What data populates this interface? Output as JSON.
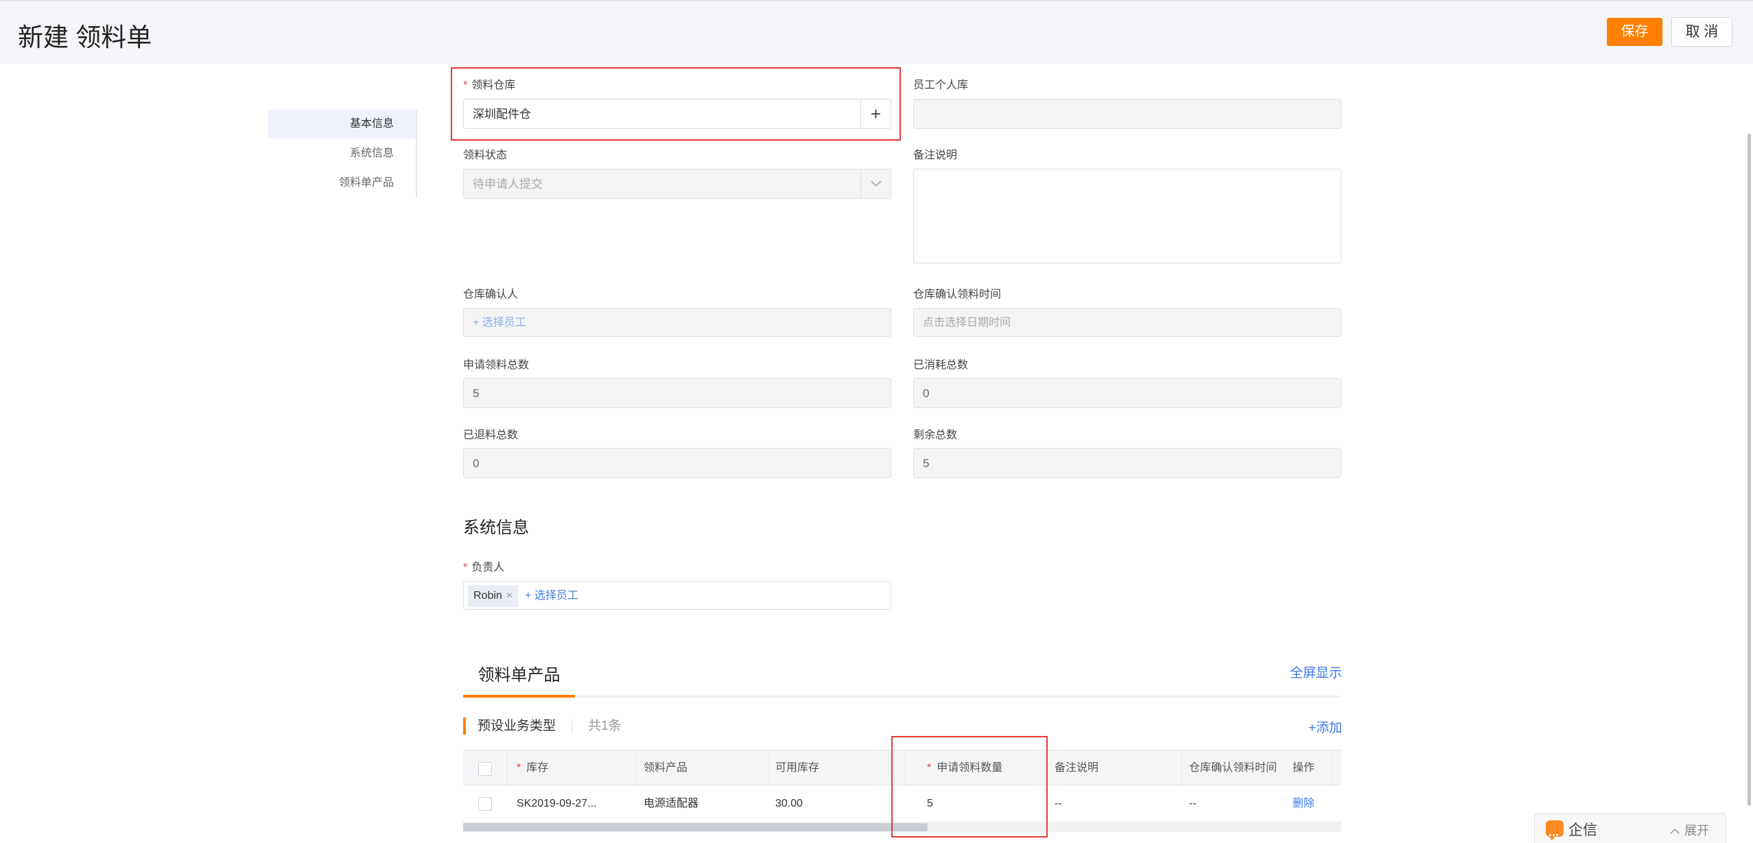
{
  "header": {
    "title": "新建 领料单",
    "save_label": "保存",
    "cancel_label": "取 消"
  },
  "sidenav": {
    "items": [
      "基本信息",
      "系统信息",
      "领料单产品"
    ]
  },
  "form": {
    "warehouse_label": "领料仓库",
    "warehouse_value": "深圳配件仓",
    "personal_store_label": "员工个人库",
    "personal_store_value": "",
    "status_label": "领料状态",
    "status_value": "待申请人提交",
    "remark_label": "备注说明",
    "confirmer_label": "仓库确认人",
    "confirmer_placeholder": "+ 选择员工",
    "confirm_time_label": "仓库确认领料时间",
    "confirm_time_placeholder": "点击选择日期时间",
    "apply_total_label": "申请领料总数",
    "apply_total_value": "5",
    "consumed_label": "已消耗总数",
    "consumed_value": "0",
    "returned_label": "已退料总数",
    "returned_value": "0",
    "remaining_label": "剩余总数",
    "remaining_value": "5"
  },
  "system": {
    "title": "系统信息",
    "owner_label": "负责人",
    "owner_tag": "Robin",
    "owner_tag_close": "×",
    "add_employee": "+ 选择员工"
  },
  "products": {
    "tab": "领料单产品",
    "fullscreen": "全屏显示",
    "biz_type": "预设业务类型",
    "count": "共1条",
    "add": "+添加",
    "columns": [
      "库存",
      "领料产品",
      "可用库存",
      "申请领料数量",
      "备注说明",
      "仓库确认领料时间",
      "操作"
    ],
    "row": {
      "stock": "SK2019-09-27...",
      "product": "电源适配器",
      "available": "30.00",
      "qty": "5",
      "remark": "--",
      "confirm_time": "--",
      "action": "删除"
    }
  },
  "qixin": {
    "title": "企信",
    "expand": "展开",
    "expand_icon": "chevron-up-icon"
  },
  "colors": {
    "accent": "#ff7f00",
    "link": "#3b7be8",
    "required": "#f23b3b",
    "highlight": "#e53935"
  }
}
